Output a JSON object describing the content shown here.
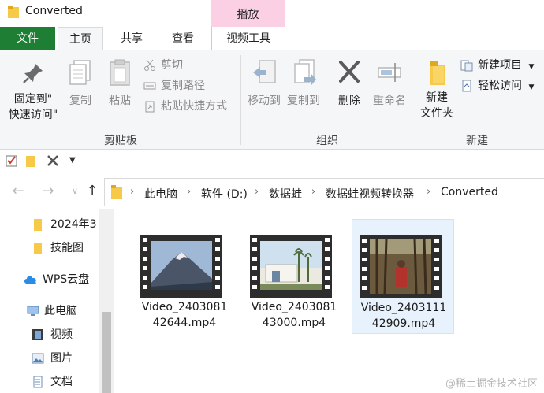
{
  "window": {
    "title": "Converted"
  },
  "ribbon_tabs": {
    "file": "文件",
    "home": "主页",
    "share": "共享",
    "view": "查看",
    "context_group": "播放",
    "video_tools": "视频工具"
  },
  "clipboard": {
    "pin_line1": "固定到\"",
    "pin_line2": "快速访问\"",
    "copy": "复制",
    "paste": "粘贴",
    "cut": "剪切",
    "copy_path": "复制路径",
    "paste_shortcut": "粘贴快捷方式",
    "group_label": "剪贴板"
  },
  "organize": {
    "move_to": "移动到",
    "copy_to": "复制到",
    "delete": "删除",
    "rename": "重命名",
    "group_label": "组织"
  },
  "new": {
    "new_folder_line1": "新建",
    "new_folder_line2": "文件夹",
    "new_item": "新建项目",
    "easy_access": "轻松访问",
    "group_label": "新建"
  },
  "address": {
    "crumbs": [
      "此电脑",
      "软件 (D:)",
      "数据蛙",
      "数据蛙视频转换器",
      "Converted"
    ]
  },
  "sidebar": {
    "items": [
      "2024年3",
      "技能图",
      "WPS云盘",
      "此电脑",
      "视频",
      "图片",
      "文档"
    ]
  },
  "files": [
    {
      "line1": "Video_2403081",
      "line2": "42644.mp4",
      "thumb": "mountain"
    },
    {
      "line1": "Video_2403081",
      "line2": "43000.mp4",
      "thumb": "building"
    },
    {
      "line1": "Video_2403111",
      "line2": "42909.mp4",
      "thumb": "forest"
    }
  ],
  "watermark": "@稀土掘金技术社区",
  "colors": {
    "file_tab": "#1e7e34",
    "context_tab": "#fbcfe4",
    "selection": "#e8f2fc"
  }
}
